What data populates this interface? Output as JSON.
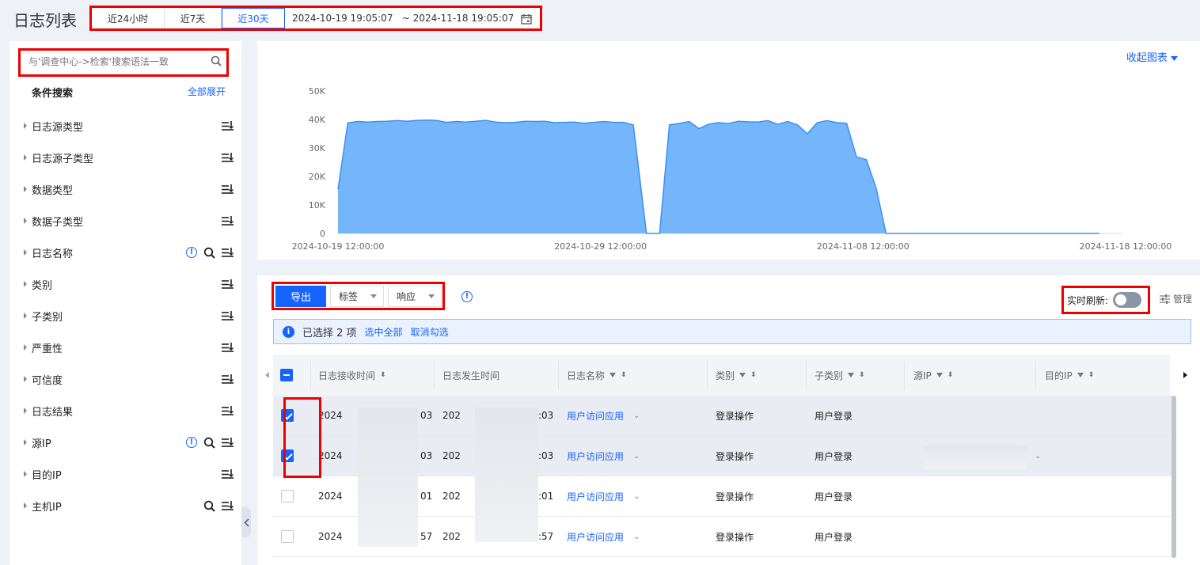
{
  "header": {
    "title": "日志列表",
    "quick_ranges": [
      "近24小时",
      "近7天",
      "近30天"
    ],
    "active_range": "近30天",
    "date_range": "2024-10-19 19:05:07   ~ 2024-11-18 19:05:07"
  },
  "sidebar": {
    "search_placeholder": "与'调查中心->检索'搜索语法一致",
    "condition_title": "条件搜索",
    "expand_all": "全部展开",
    "items": [
      {
        "label": "日志源类型",
        "info": false,
        "search": false
      },
      {
        "label": "日志源子类型",
        "info": false,
        "search": false
      },
      {
        "label": "数据类型",
        "info": false,
        "search": false
      },
      {
        "label": "数据子类型",
        "info": false,
        "search": false
      },
      {
        "label": "日志名称",
        "info": true,
        "search": true
      },
      {
        "label": "类别",
        "info": false,
        "search": false
      },
      {
        "label": "子类别",
        "info": false,
        "search": false
      },
      {
        "label": "严重性",
        "info": false,
        "search": false
      },
      {
        "label": "可信度",
        "info": false,
        "search": false
      },
      {
        "label": "日志结果",
        "info": false,
        "search": false
      },
      {
        "label": "源IP",
        "info": true,
        "search": true
      },
      {
        "label": "目的IP",
        "info": false,
        "search": false
      },
      {
        "label": "主机IP",
        "info": false,
        "search": true
      }
    ]
  },
  "chart": {
    "collapse_label": "收起图表",
    "accent_color": "#74b6f9",
    "line_color": "#3d8ff5"
  },
  "chart_data": {
    "type": "area",
    "y_ticks": [
      "50K",
      "40K",
      "30K",
      "20K",
      "10K",
      "0"
    ],
    "ylim": [
      0,
      50000
    ],
    "x_tick_labels": [
      "2024-10-19 12:00:00",
      "2024-10-29 12:00:00",
      "2024-11-08 12:00:00",
      "2024-11-18 12:00:00"
    ],
    "x_start": "2024-10-19 12:00:00",
    "x_end": "2024-11-18 12:00:00",
    "series": [
      {
        "points": [
          [
            "2024-10-19 12:00:00",
            15500
          ],
          [
            "2024-10-19 21:00:00",
            38800
          ],
          [
            "2024-10-20 06:00:00",
            39300
          ],
          [
            "2024-10-20 15:00:00",
            39100
          ],
          [
            "2024-10-21 00:00:00",
            39300
          ],
          [
            "2024-10-21 09:00:00",
            39400
          ],
          [
            "2024-10-21 18:00:00",
            39600
          ],
          [
            "2024-10-22 03:00:00",
            39400
          ],
          [
            "2024-10-22 12:00:00",
            39700
          ],
          [
            "2024-10-22 21:00:00",
            39800
          ],
          [
            "2024-10-23 06:00:00",
            39700
          ],
          [
            "2024-10-23 15:00:00",
            39000
          ],
          [
            "2024-10-24 00:00:00",
            39300
          ],
          [
            "2024-10-24 09:00:00",
            39100
          ],
          [
            "2024-10-24 18:00:00",
            39400
          ],
          [
            "2024-10-25 03:00:00",
            39700
          ],
          [
            "2024-10-25 12:00:00",
            39100
          ],
          [
            "2024-10-25 21:00:00",
            38900
          ],
          [
            "2024-10-26 06:00:00",
            39000
          ],
          [
            "2024-10-26 15:00:00",
            39400
          ],
          [
            "2024-10-27 00:00:00",
            39300
          ],
          [
            "2024-10-27 09:00:00",
            39400
          ],
          [
            "2024-10-27 18:00:00",
            38900
          ],
          [
            "2024-10-28 03:00:00",
            39000
          ],
          [
            "2024-10-28 12:00:00",
            39100
          ],
          [
            "2024-10-28 21:00:00",
            38700
          ],
          [
            "2024-10-29 06:00:00",
            39000
          ],
          [
            "2024-10-29 15:00:00",
            39300
          ],
          [
            "2024-10-30 00:00:00",
            39000
          ],
          [
            "2024-10-30 09:00:00",
            39000
          ],
          [
            "2024-10-30 18:00:00",
            38100
          ],
          [
            "2024-10-31 06:00:00",
            0
          ],
          [
            "2024-10-31 18:00:00",
            0
          ],
          [
            "2024-11-01 03:00:00",
            38100
          ],
          [
            "2024-11-01 12:00:00",
            38600
          ],
          [
            "2024-11-01 21:00:00",
            39300
          ],
          [
            "2024-11-02 06:00:00",
            36800
          ],
          [
            "2024-11-02 15:00:00",
            38400
          ],
          [
            "2024-11-03 00:00:00",
            38900
          ],
          [
            "2024-11-03 09:00:00",
            38600
          ],
          [
            "2024-11-03 18:00:00",
            39400
          ],
          [
            "2024-11-04 03:00:00",
            39200
          ],
          [
            "2024-11-04 12:00:00",
            39100
          ],
          [
            "2024-11-04 21:00:00",
            39600
          ],
          [
            "2024-11-05 06:00:00",
            38300
          ],
          [
            "2024-11-05 15:00:00",
            39300
          ],
          [
            "2024-11-06 00:00:00",
            38100
          ],
          [
            "2024-11-06 09:00:00",
            35000
          ],
          [
            "2024-11-06 18:00:00",
            38900
          ],
          [
            "2024-11-07 03:00:00",
            39600
          ],
          [
            "2024-11-07 12:00:00",
            38900
          ],
          [
            "2024-11-07 21:00:00",
            38700
          ],
          [
            "2024-11-08 06:00:00",
            26900
          ],
          [
            "2024-11-08 15:00:00",
            25900
          ],
          [
            "2024-11-09 00:00:00",
            15900
          ],
          [
            "2024-11-09 09:00:00",
            0
          ],
          [
            "2024-11-17 12:00:00",
            0
          ]
        ]
      }
    ]
  },
  "toolbar": {
    "export_label": "导出",
    "tag_label": "标签",
    "response_label": "响应",
    "realtime_label": "实时刷新:",
    "manage_label": "管理"
  },
  "selection": {
    "text": "已选择 2 项",
    "select_all": "选中全部",
    "cancel": "取消勾选"
  },
  "table": {
    "columns": [
      "日志接收时间",
      "日志发生时间",
      "日志名称",
      "类别",
      "子类别",
      "源IP",
      "目的IP"
    ],
    "rows": [
      {
        "checked": true,
        "recv_prefix": "2024",
        "recv_suffix": "03",
        "occ_prefix": "202",
        "occ_suffix": ":03",
        "name": "用户访问应用",
        "category": "登录操作",
        "subcategory": "用户登录"
      },
      {
        "checked": true,
        "recv_prefix": "2024",
        "recv_suffix": "03",
        "occ_prefix": "202",
        "occ_suffix": ":03",
        "name": "用户访问应用",
        "category": "登录操作",
        "subcategory": "用户登录"
      },
      {
        "checked": false,
        "recv_prefix": "2024",
        "recv_suffix": "01",
        "occ_prefix": "202",
        "occ_suffix": ":01",
        "name": "用户访问应用",
        "category": "登录操作",
        "subcategory": "用户登录"
      },
      {
        "checked": false,
        "recv_prefix": "2024",
        "recv_suffix": "57",
        "occ_prefix": "202",
        "occ_suffix": ":57",
        "name": "用户访问应用",
        "category": "登录操作",
        "subcategory": "用户登录"
      }
    ]
  }
}
